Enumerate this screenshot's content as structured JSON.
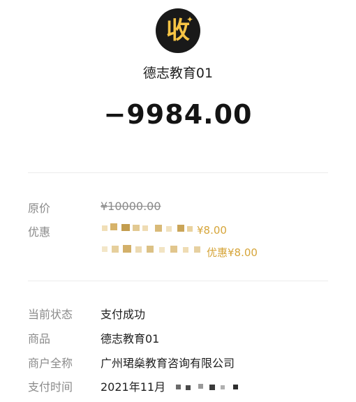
{
  "header": {
    "logo_char": "收",
    "logo_star": "✦",
    "merchant_name": "德志教育01",
    "amount": "−9984.00"
  },
  "details": {
    "original_price_label": "原价",
    "original_price_value": "¥10000.00",
    "discount_label": "优惠",
    "discount_1_suffix": "¥8.00",
    "discount_2_suffix": "优惠¥8.00",
    "status_label": "当前状态",
    "status_value": "支付成功",
    "product_label": "商品",
    "product_value": "德志教育01",
    "merchant_fullname_label": "商户全称",
    "merchant_fullname_value": "广州珺燊教育咨询有限公司",
    "pay_time_label": "支付时间",
    "pay_time_value": "2021年11月"
  },
  "colors": {
    "accent_gold": "#d6a53a",
    "logo_bg": "#191919",
    "logo_fg": "#f6c445"
  }
}
